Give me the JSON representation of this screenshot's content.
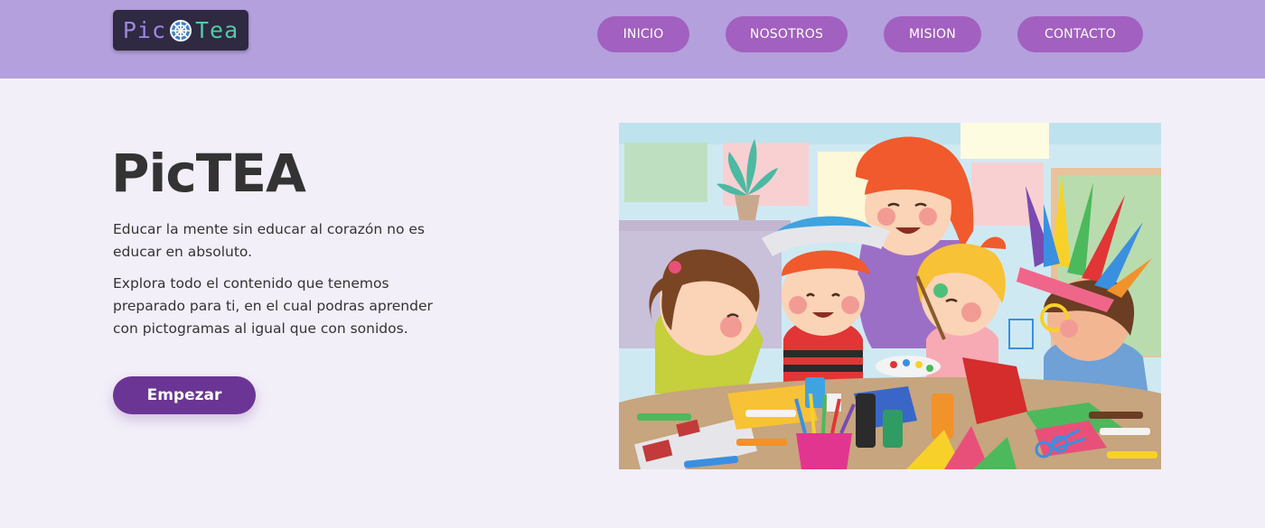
{
  "header": {
    "logo": {
      "text_left": "Pic",
      "text_right": "Tea"
    },
    "nav": [
      {
        "label": "INICIO"
      },
      {
        "label": "NOSOTROS"
      },
      {
        "label": "MISION"
      },
      {
        "label": "CONTACTO"
      }
    ]
  },
  "hero": {
    "title": "PicTEA",
    "paragraph1": "Educar la mente sin educar al corazón no es educar en absoluto.",
    "paragraph2": "Explora todo el contenido que tenemos preparado para ti, en el cual podras aprender con pictogramas al igual que con sonidos.",
    "cta_label": "Empezar"
  },
  "colors": {
    "header_bg": "#b4a0dc",
    "page_bg": "#f3eff9",
    "nav_button": "#a260c0",
    "cta_button": "#6a3594"
  }
}
